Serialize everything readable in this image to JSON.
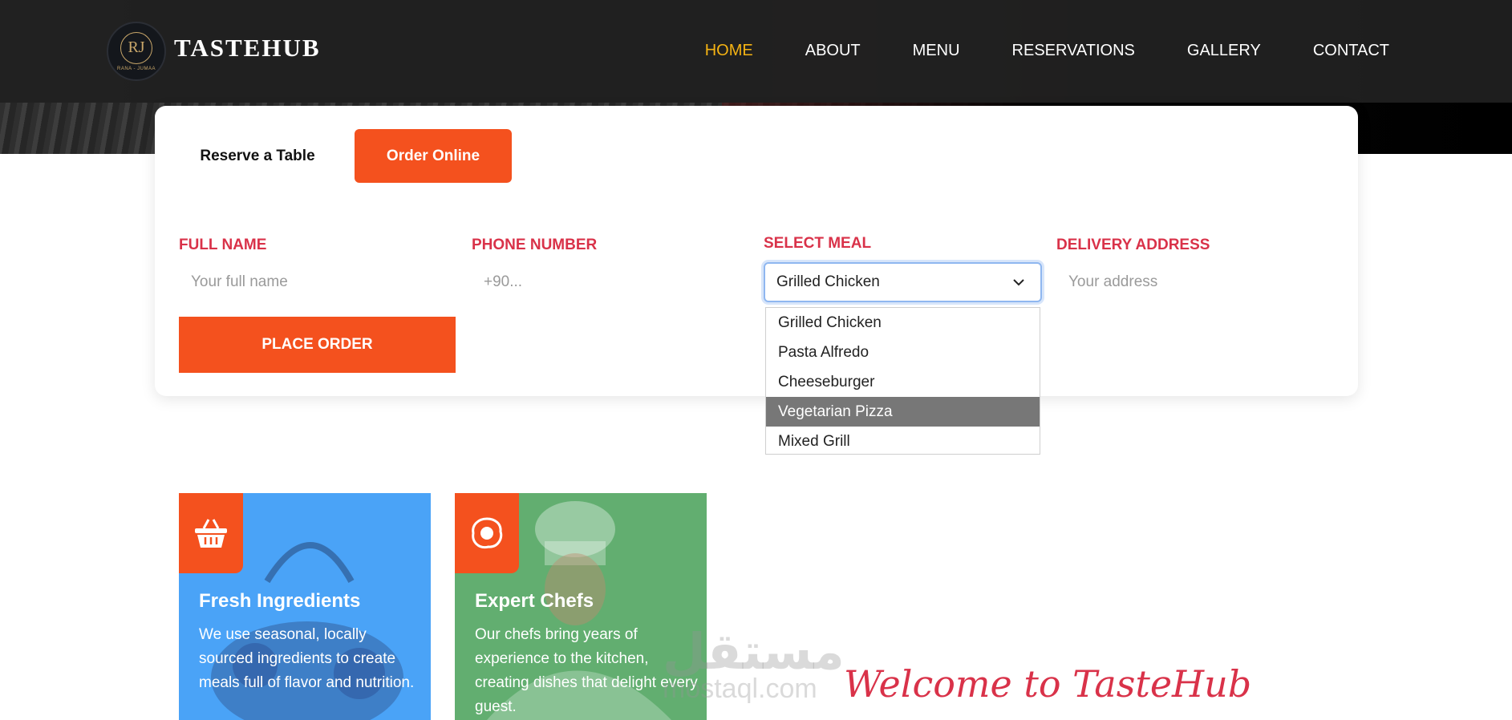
{
  "brand": {
    "name": "TASTEHUB",
    "logo_monogram": "RJ",
    "logo_subtext": "RANA - JUMAA"
  },
  "nav": {
    "items": [
      {
        "label": "HOME",
        "active": true
      },
      {
        "label": "ABOUT",
        "active": false
      },
      {
        "label": "MENU",
        "active": false
      },
      {
        "label": "RESERVATIONS",
        "active": false
      },
      {
        "label": "GALLERY",
        "active": false
      },
      {
        "label": "CONTACT",
        "active": false
      }
    ],
    "active_color": "#f5b313"
  },
  "booking": {
    "tabs": [
      {
        "label": "Reserve a Table",
        "selected": false
      },
      {
        "label": "Order Online",
        "selected": true
      }
    ],
    "fields": {
      "full_name": {
        "label": "FULL NAME",
        "placeholder": "Your full name",
        "value": ""
      },
      "phone": {
        "label": "PHONE NUMBER",
        "placeholder": "+90...",
        "value": ""
      },
      "meal": {
        "label": "SELECT MEAL",
        "value": "Grilled Chicken"
      },
      "address": {
        "label": "DELIVERY ADDRESS",
        "placeholder": "Your address",
        "value": ""
      }
    },
    "submit_label": "PLACE ORDER",
    "meal_options": [
      "Grilled Chicken",
      "Pasta Alfredo",
      "Cheeseburger",
      "Vegetarian Pizza",
      "Mixed Grill"
    ],
    "highlighted_option": "Vegetarian Pizza"
  },
  "features": [
    {
      "title": "Fresh Ingredients",
      "text": "We use seasonal, locally sourced ingredients to create meals full of flavor and nutrition.",
      "icon": "basket-icon",
      "color": "#4aa3f7"
    },
    {
      "title": "Expert Chefs",
      "text": "Our chefs bring years of experience to the kitchen, creating dishes that delight every guest.",
      "icon": "fried-egg-icon",
      "color": "#62ae70"
    }
  ],
  "welcome": "Welcome to TasteHub",
  "watermark": {
    "arabic": "مستقل",
    "latin": "mostaql.com"
  },
  "colors": {
    "accent": "#f4511e",
    "label": "#d93249"
  }
}
